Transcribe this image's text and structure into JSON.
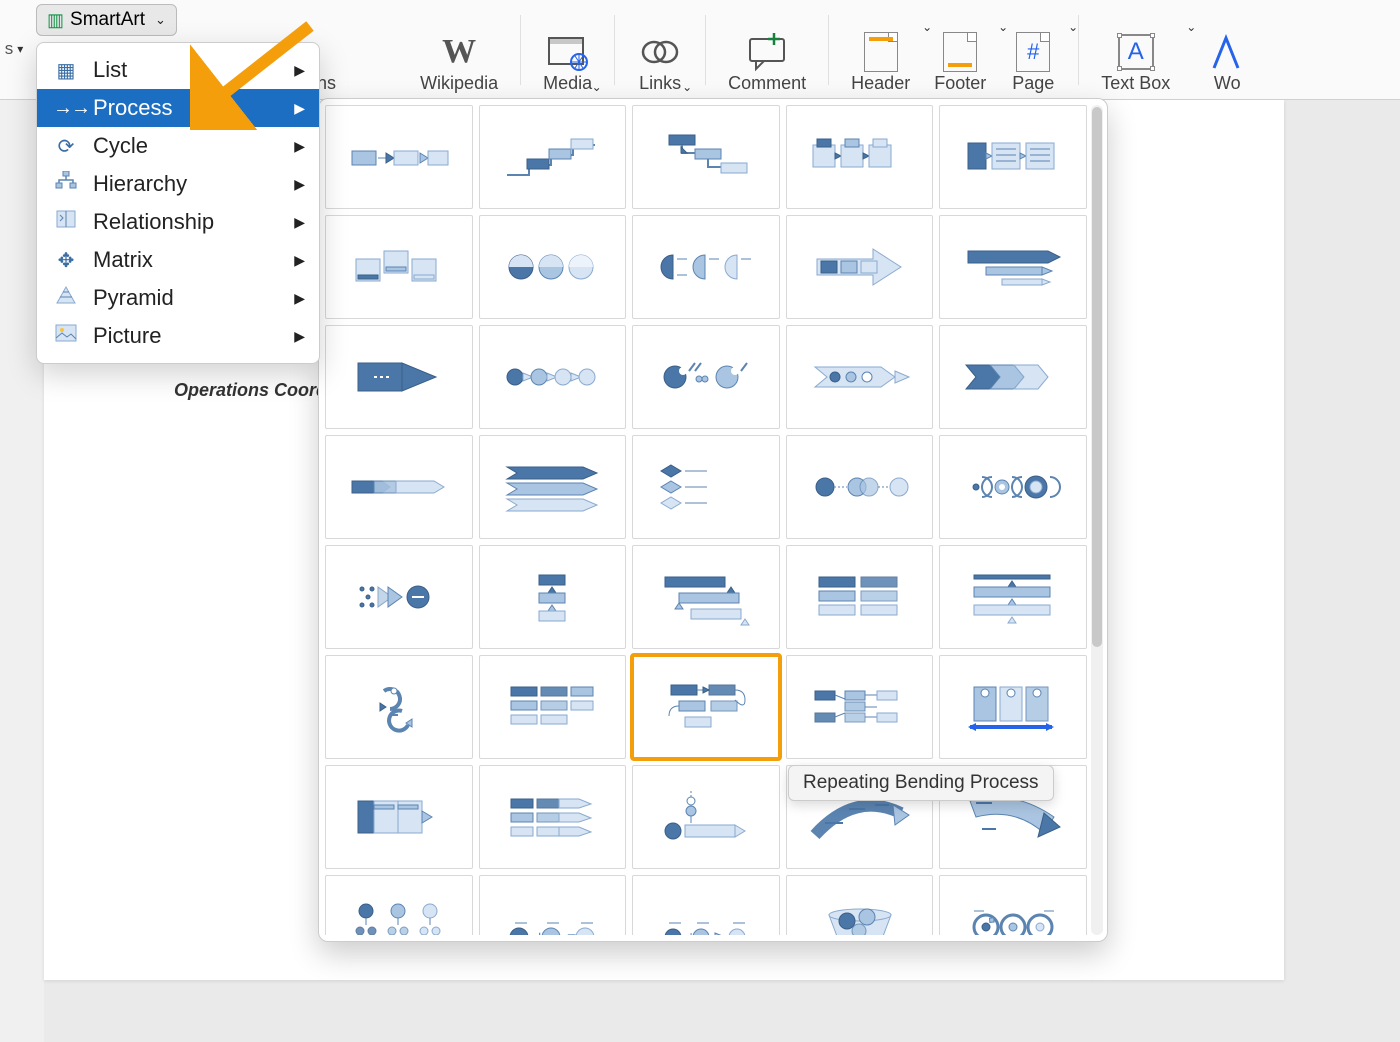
{
  "ribbon": {
    "smartart_label": "SmartArt",
    "left_frag": "s",
    "addins_label": "Get Add-ins",
    "wikipedia_label": "Wikipedia",
    "media_label": "Media",
    "links_label": "Links",
    "comment_label": "Comment",
    "header_label": "Header",
    "footer_label": "Footer",
    "page_label": "Page",
    "textbox_label": "Text Box",
    "word_frag": "Wo",
    "pageno_char": "#"
  },
  "menu": {
    "items": [
      {
        "label": "List",
        "icon": "list"
      },
      {
        "label": "Process",
        "icon": "process"
      },
      {
        "label": "Cycle",
        "icon": "cycle"
      },
      {
        "label": "Hierarchy",
        "icon": "hierarchy"
      },
      {
        "label": "Relationship",
        "icon": "relationship"
      },
      {
        "label": "Matrix",
        "icon": "matrix"
      },
      {
        "label": "Pyramid",
        "icon": "pyramid"
      },
      {
        "label": "Picture",
        "icon": "picture"
      }
    ],
    "selected_index": 1
  },
  "gallery": {
    "highlighted_index": 27,
    "tooltip": "Repeating Bending Process"
  },
  "doc": {
    "partial_text": "Operations Coord"
  }
}
